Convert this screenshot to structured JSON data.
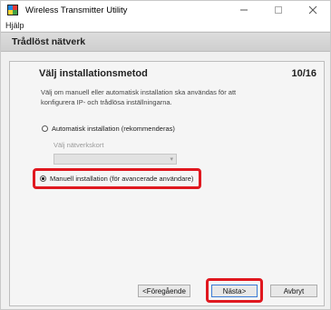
{
  "window": {
    "title": "Wireless Transmitter Utility",
    "icons": {
      "app": "app-icon",
      "minimize": "minimize-icon",
      "maximize": "maximize-icon",
      "close": "close-icon"
    }
  },
  "menu": {
    "items": [
      {
        "label": "Hjälp"
      }
    ]
  },
  "section": {
    "title": "Trådlöst nätverk"
  },
  "panel": {
    "title": "Välj installationsmetod",
    "step": "10/16",
    "description_line1": "Välj om manuell eller automatisk installation ska användas för att",
    "description_line2": "konfigurera IP- och trådlösa inställningarna.",
    "options": [
      {
        "label": "Automatisk installation (rekommenderas)",
        "selected": false
      },
      {
        "label": "Manuell installation (för avancerade användare)",
        "selected": true
      }
    ],
    "network_select": {
      "label": "Välj nätverkskort",
      "value": "",
      "enabled": false
    }
  },
  "buttons": {
    "previous": "<Föregående",
    "next": "Nästa>",
    "cancel": "Avbryt"
  },
  "colors": {
    "highlight": "#e0181f",
    "header_bg": "#d6d6d6",
    "panel_bg": "#f5f5f5"
  }
}
